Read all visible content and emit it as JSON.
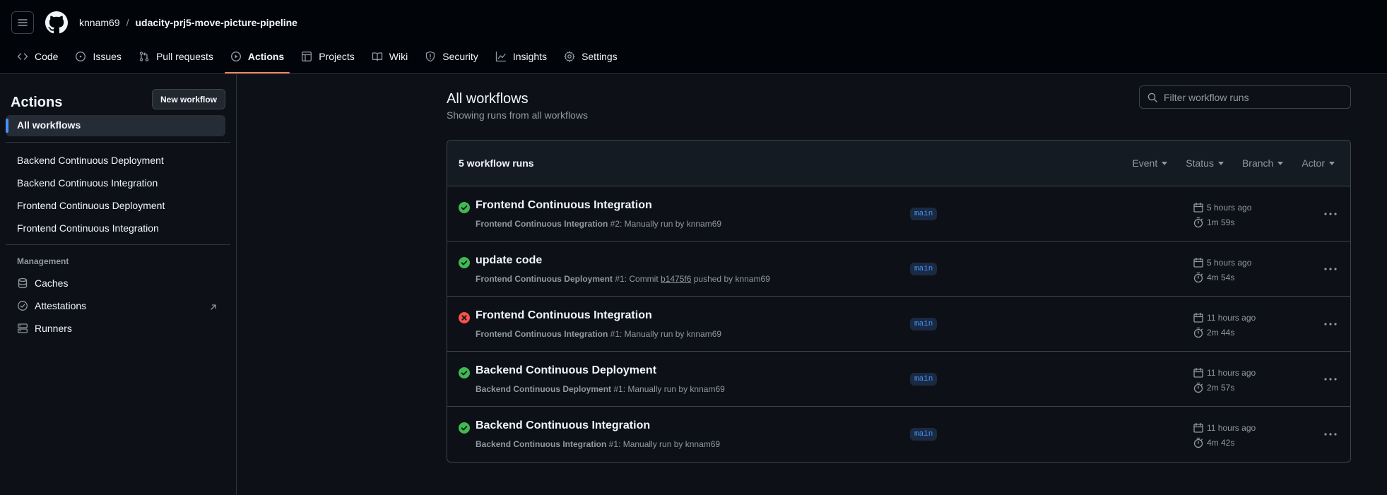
{
  "header": {
    "owner": "knnam69",
    "separator": "/",
    "repo": "udacity-prj5-move-picture-pipeline"
  },
  "tabs": [
    {
      "label": "Code",
      "icon": "code-icon"
    },
    {
      "label": "Issues",
      "icon": "issue-icon"
    },
    {
      "label": "Pull requests",
      "icon": "pull-request-icon"
    },
    {
      "label": "Actions",
      "icon": "play-icon",
      "active": true
    },
    {
      "label": "Projects",
      "icon": "table-icon"
    },
    {
      "label": "Wiki",
      "icon": "book-icon"
    },
    {
      "label": "Security",
      "icon": "shield-icon"
    },
    {
      "label": "Insights",
      "icon": "graph-icon"
    },
    {
      "label": "Settings",
      "icon": "gear-icon"
    }
  ],
  "sidebar": {
    "title": "Actions",
    "new_workflow_label": "New workflow",
    "all_workflows_label": "All workflows",
    "workflows": [
      "Backend Continuous Deployment",
      "Backend Continuous Integration",
      "Frontend Continuous Deployment",
      "Frontend Continuous Integration"
    ],
    "management_heading": "Management",
    "management": [
      {
        "label": "Caches",
        "icon": "database-icon"
      },
      {
        "label": "Attestations",
        "icon": "verified-icon"
      },
      {
        "label": "Runners",
        "icon": "server-icon"
      }
    ]
  },
  "main": {
    "title": "All workflows",
    "subtitle": "Showing runs from all workflows",
    "filter_placeholder": "Filter workflow runs",
    "runs_count": "5 workflow runs",
    "filters": [
      "Event",
      "Status",
      "Branch",
      "Actor"
    ],
    "runs": [
      {
        "status": "success",
        "title": "Frontend Continuous Integration",
        "workflow": "Frontend Continuous Integration",
        "detail": " #2: Manually run by knnam69",
        "branch": "main",
        "when": "5 hours ago",
        "duration": "1m 59s"
      },
      {
        "status": "success",
        "title": "update code",
        "workflow": "Frontend Continuous Deployment",
        "detail": " #1: Commit ",
        "sha": "b1475f6",
        "detail_after": " pushed by knnam69",
        "branch": "main",
        "when": "5 hours ago",
        "duration": "4m 54s"
      },
      {
        "status": "failure",
        "title": "Frontend Continuous Integration",
        "workflow": "Frontend Continuous Integration",
        "detail": " #1: Manually run by knnam69",
        "branch": "main",
        "when": "11 hours ago",
        "duration": "2m 44s"
      },
      {
        "status": "success",
        "title": "Backend Continuous Deployment",
        "workflow": "Backend Continuous Deployment",
        "detail": " #1: Manually run by knnam69",
        "branch": "main",
        "when": "11 hours ago",
        "duration": "2m 57s"
      },
      {
        "status": "success",
        "title": "Backend Continuous Integration",
        "workflow": "Backend Continuous Integration",
        "detail": " #1: Manually run by knnam69",
        "branch": "main",
        "when": "11 hours ago",
        "duration": "4m 42s"
      }
    ]
  },
  "colors": {
    "success": "#3fb950",
    "failure": "#f85149",
    "accent": "#4493f8",
    "tab_underline": "#f78166"
  }
}
